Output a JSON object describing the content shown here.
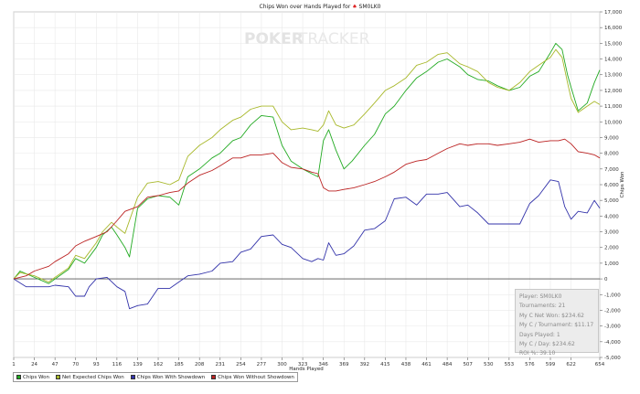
{
  "chart_data": {
    "type": "line",
    "title": "Chips Won over Hands Played for",
    "player_name": "SM0LK0",
    "watermark_left": "POKER",
    "watermark_right": "TRACKER",
    "xlabel": "Hands Played",
    "ylabel": "Chips Won",
    "xlim": [
      1,
      654
    ],
    "ylim": [
      -5000,
      17000
    ],
    "x_ticks": [
      1,
      24,
      47,
      70,
      93,
      116,
      139,
      162,
      185,
      208,
      231,
      254,
      277,
      300,
      323,
      346,
      369,
      392,
      415,
      438,
      461,
      484,
      507,
      530,
      553,
      576,
      599,
      622,
      654
    ],
    "y_ticks": [
      -5000,
      -4000,
      -3000,
      -2000,
      -1000,
      0,
      1000,
      2000,
      3000,
      4000,
      5000,
      6000,
      7000,
      8000,
      9000,
      10000,
      11000,
      12000,
      13000,
      14000,
      15000,
      16000,
      17000
    ],
    "legend_position": "bottom-left",
    "series": [
      {
        "name": "Chips Won",
        "color": "#22aa22",
        "points": [
          [
            1,
            0
          ],
          [
            8,
            500
          ],
          [
            24,
            100
          ],
          [
            40,
            -300
          ],
          [
            47,
            0
          ],
          [
            62,
            600
          ],
          [
            70,
            1300
          ],
          [
            80,
            1000
          ],
          [
            93,
            2000
          ],
          [
            100,
            2800
          ],
          [
            110,
            3300
          ],
          [
            116,
            2800
          ],
          [
            125,
            2000
          ],
          [
            130,
            1400
          ],
          [
            139,
            4500
          ],
          [
            150,
            5100
          ],
          [
            162,
            5300
          ],
          [
            175,
            5200
          ],
          [
            185,
            4700
          ],
          [
            195,
            6500
          ],
          [
            208,
            7000
          ],
          [
            222,
            7700
          ],
          [
            231,
            8000
          ],
          [
            245,
            8800
          ],
          [
            254,
            9000
          ],
          [
            265,
            9800
          ],
          [
            277,
            10400
          ],
          [
            290,
            10300
          ],
          [
            300,
            8500
          ],
          [
            310,
            7500
          ],
          [
            323,
            7000
          ],
          [
            333,
            6700
          ],
          [
            340,
            6500
          ],
          [
            346,
            8800
          ],
          [
            352,
            9500
          ],
          [
            360,
            8200
          ],
          [
            369,
            7000
          ],
          [
            378,
            7500
          ],
          [
            392,
            8500
          ],
          [
            403,
            9200
          ],
          [
            415,
            10500
          ],
          [
            425,
            11000
          ],
          [
            438,
            12000
          ],
          [
            450,
            12800
          ],
          [
            461,
            13200
          ],
          [
            474,
            13800
          ],
          [
            484,
            14000
          ],
          [
            498,
            13500
          ],
          [
            507,
            13000
          ],
          [
            518,
            12700
          ],
          [
            530,
            12600
          ],
          [
            540,
            12300
          ],
          [
            553,
            12000
          ],
          [
            565,
            12200
          ],
          [
            576,
            12900
          ],
          [
            586,
            13200
          ],
          [
            599,
            14400
          ],
          [
            605,
            15000
          ],
          [
            612,
            14600
          ],
          [
            618,
            13000
          ],
          [
            622,
            12200
          ],
          [
            630,
            10700
          ],
          [
            640,
            11200
          ],
          [
            648,
            12500
          ],
          [
            654,
            13300
          ]
        ]
      },
      {
        "name": "Net Expected Chips Won",
        "color": "#a8b82a",
        "points": [
          [
            1,
            0
          ],
          [
            8,
            400
          ],
          [
            24,
            200
          ],
          [
            40,
            -200
          ],
          [
            47,
            100
          ],
          [
            62,
            700
          ],
          [
            70,
            1500
          ],
          [
            80,
            1300
          ],
          [
            93,
            2300
          ],
          [
            100,
            3000
          ],
          [
            110,
            3600
          ],
          [
            116,
            3300
          ],
          [
            125,
            2900
          ],
          [
            139,
            5200
          ],
          [
            150,
            6100
          ],
          [
            162,
            6200
          ],
          [
            175,
            6000
          ],
          [
            185,
            6300
          ],
          [
            195,
            7800
          ],
          [
            208,
            8500
          ],
          [
            222,
            9000
          ],
          [
            231,
            9500
          ],
          [
            245,
            10100
          ],
          [
            254,
            10300
          ],
          [
            265,
            10800
          ],
          [
            277,
            11000
          ],
          [
            290,
            11000
          ],
          [
            300,
            10000
          ],
          [
            310,
            9500
          ],
          [
            323,
            9600
          ],
          [
            333,
            9500
          ],
          [
            340,
            9400
          ],
          [
            346,
            9800
          ],
          [
            352,
            10700
          ],
          [
            360,
            9800
          ],
          [
            369,
            9600
          ],
          [
            380,
            9800
          ],
          [
            392,
            10500
          ],
          [
            403,
            11200
          ],
          [
            415,
            12000
          ],
          [
            425,
            12300
          ],
          [
            438,
            12800
          ],
          [
            450,
            13600
          ],
          [
            461,
            13800
          ],
          [
            474,
            14300
          ],
          [
            484,
            14400
          ],
          [
            498,
            13700
          ],
          [
            507,
            13500
          ],
          [
            518,
            13200
          ],
          [
            530,
            12500
          ],
          [
            540,
            12200
          ],
          [
            553,
            12000
          ],
          [
            565,
            12500
          ],
          [
            576,
            13200
          ],
          [
            586,
            13600
          ],
          [
            599,
            14100
          ],
          [
            605,
            14600
          ],
          [
            612,
            14100
          ],
          [
            618,
            12500
          ],
          [
            622,
            11500
          ],
          [
            630,
            10600
          ],
          [
            640,
            11000
          ],
          [
            648,
            11300
          ],
          [
            654,
            11100
          ]
        ]
      },
      {
        "name": "Chips Won With Showdown",
        "color": "#3333aa",
        "points": [
          [
            1,
            0
          ],
          [
            15,
            -500
          ],
          [
            24,
            -500
          ],
          [
            40,
            -500
          ],
          [
            47,
            -400
          ],
          [
            62,
            -500
          ],
          [
            70,
            -1100
          ],
          [
            80,
            -1100
          ],
          [
            85,
            -500
          ],
          [
            93,
            0
          ],
          [
            105,
            100
          ],
          [
            116,
            -500
          ],
          [
            125,
            -800
          ],
          [
            130,
            -1900
          ],
          [
            139,
            -1700
          ],
          [
            150,
            -1600
          ],
          [
            162,
            -600
          ],
          [
            175,
            -600
          ],
          [
            185,
            -200
          ],
          [
            195,
            200
          ],
          [
            208,
            300
          ],
          [
            222,
            500
          ],
          [
            231,
            1000
          ],
          [
            245,
            1100
          ],
          [
            254,
            1700
          ],
          [
            265,
            1900
          ],
          [
            277,
            2700
          ],
          [
            290,
            2800
          ],
          [
            300,
            2200
          ],
          [
            310,
            2000
          ],
          [
            323,
            1300
          ],
          [
            333,
            1100
          ],
          [
            340,
            1300
          ],
          [
            346,
            1200
          ],
          [
            352,
            2300
          ],
          [
            360,
            1500
          ],
          [
            369,
            1600
          ],
          [
            380,
            2100
          ],
          [
            392,
            3100
          ],
          [
            403,
            3200
          ],
          [
            415,
            3700
          ],
          [
            425,
            5100
          ],
          [
            438,
            5200
          ],
          [
            450,
            4700
          ],
          [
            461,
            5400
          ],
          [
            474,
            5400
          ],
          [
            484,
            5500
          ],
          [
            498,
            4600
          ],
          [
            507,
            4700
          ],
          [
            518,
            4200
          ],
          [
            530,
            3500
          ],
          [
            540,
            3500
          ],
          [
            553,
            3500
          ],
          [
            565,
            3500
          ],
          [
            576,
            4800
          ],
          [
            586,
            5300
          ],
          [
            599,
            6300
          ],
          [
            608,
            6200
          ],
          [
            615,
            4600
          ],
          [
            622,
            3800
          ],
          [
            630,
            4300
          ],
          [
            640,
            4200
          ],
          [
            648,
            5000
          ],
          [
            654,
            4500
          ]
        ]
      },
      {
        "name": "Chips Won Without Showdown",
        "color": "#bb2222",
        "points": [
          [
            1,
            0
          ],
          [
            15,
            200
          ],
          [
            24,
            500
          ],
          [
            40,
            800
          ],
          [
            47,
            1100
          ],
          [
            62,
            1600
          ],
          [
            70,
            2100
          ],
          [
            80,
            2400
          ],
          [
            93,
            2700
          ],
          [
            105,
            3000
          ],
          [
            116,
            3700
          ],
          [
            125,
            4300
          ],
          [
            139,
            4600
          ],
          [
            150,
            5200
          ],
          [
            162,
            5300
          ],
          [
            175,
            5500
          ],
          [
            185,
            5600
          ],
          [
            195,
            6100
          ],
          [
            208,
            6600
          ],
          [
            222,
            6900
          ],
          [
            231,
            7200
          ],
          [
            245,
            7700
          ],
          [
            254,
            7700
          ],
          [
            265,
            7900
          ],
          [
            277,
            7900
          ],
          [
            290,
            8000
          ],
          [
            300,
            7400
          ],
          [
            310,
            7100
          ],
          [
            323,
            7000
          ],
          [
            333,
            6800
          ],
          [
            340,
            6700
          ],
          [
            346,
            5800
          ],
          [
            352,
            5600
          ],
          [
            360,
            5600
          ],
          [
            369,
            5700
          ],
          [
            380,
            5800
          ],
          [
            392,
            6000
          ],
          [
            403,
            6200
          ],
          [
            415,
            6500
          ],
          [
            425,
            6800
          ],
          [
            438,
            7300
          ],
          [
            450,
            7500
          ],
          [
            461,
            7600
          ],
          [
            474,
            8000
          ],
          [
            484,
            8300
          ],
          [
            498,
            8600
          ],
          [
            507,
            8500
          ],
          [
            518,
            8600
          ],
          [
            530,
            8600
          ],
          [
            540,
            8500
          ],
          [
            553,
            8600
          ],
          [
            565,
            8700
          ],
          [
            576,
            8900
          ],
          [
            586,
            8700
          ],
          [
            599,
            8800
          ],
          [
            608,
            8800
          ],
          [
            615,
            8900
          ],
          [
            622,
            8600
          ],
          [
            630,
            8100
          ],
          [
            640,
            8000
          ],
          [
            648,
            7900
          ],
          [
            654,
            7700
          ]
        ]
      }
    ]
  },
  "stats": {
    "player": "Player: SM0LK0",
    "tournaments": "Tournaments: 21",
    "net_won": "My C Net Won: $234.62",
    "per_tournament": "My C / Tournament: $11.17",
    "days_played": "Days Played: 1",
    "per_day": "My C / Day: $234.62",
    "roi": "ROI %: 39.10"
  },
  "legend": [
    {
      "label": "Chips Won",
      "color": "#22aa22"
    },
    {
      "label": "Net Expected Chips Won",
      "color": "#a8b82a"
    },
    {
      "label": "Chips Won With Showdown",
      "color": "#3333aa"
    },
    {
      "label": "Chips Won Without Showdown",
      "color": "#bb2222"
    }
  ]
}
